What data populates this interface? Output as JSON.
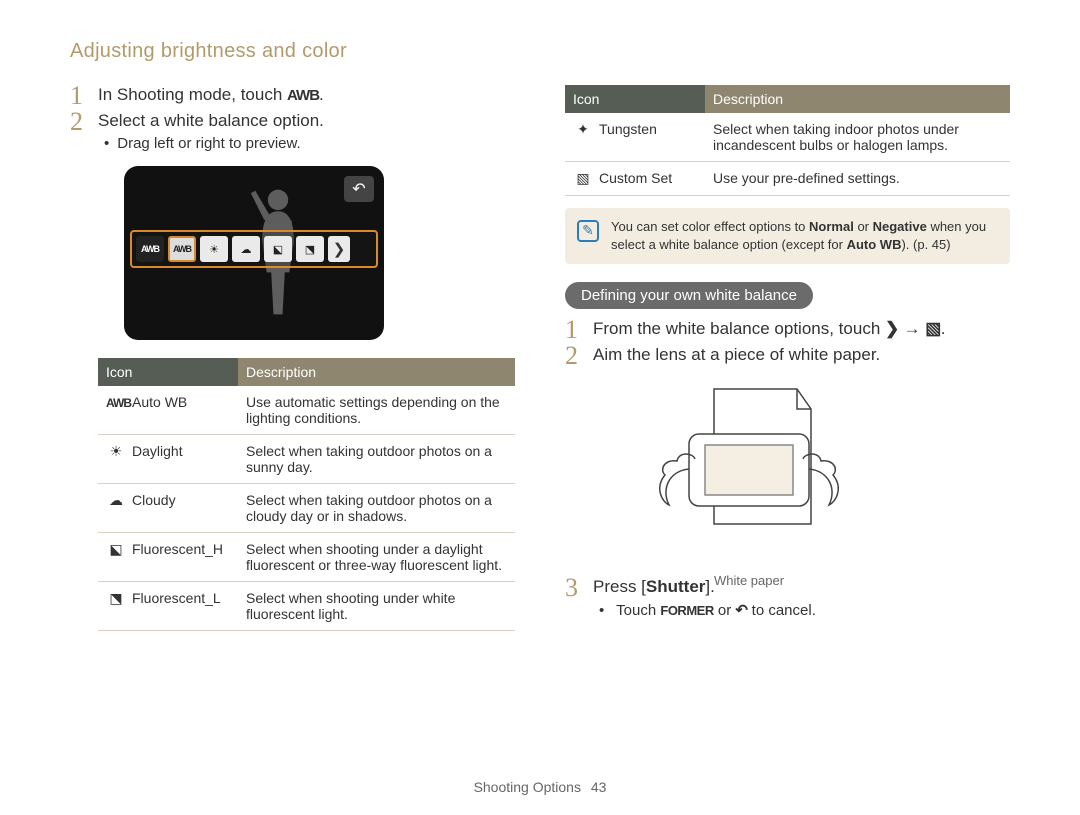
{
  "page_title": "Adjusting brightness and color",
  "left": {
    "step1_prefix": "In Shooting mode, touch ",
    "step1_icon": "AWB",
    "step1_suffix": ".",
    "step2": "Select a white balance option.",
    "step2_sub1": "Drag left or right to preview.",
    "table": {
      "headers": [
        "Icon",
        "Description"
      ],
      "rows": [
        {
          "icon_glyph": "AWB",
          "label": "Auto WB",
          "desc": "Use automatic settings depending on the lighting conditions."
        },
        {
          "icon_glyph": "☀",
          "label": "Daylight",
          "desc": "Select when taking outdoor photos on a sunny day."
        },
        {
          "icon_glyph": "☁",
          "label": "Cloudy",
          "desc": "Select when taking outdoor photos on a cloudy day or in shadows."
        },
        {
          "icon_glyph": "⬕",
          "label": "Fluorescent_H",
          "desc": "Select when shooting under a daylight fluorescent or three-way fluorescent light."
        },
        {
          "icon_glyph": "⬔",
          "label": "Fluorescent_L",
          "desc": "Select when shooting under white fluorescent light."
        }
      ]
    }
  },
  "right": {
    "table": {
      "headers": [
        "Icon",
        "Description"
      ],
      "rows": [
        {
          "icon_glyph": "✦",
          "label": "Tungsten",
          "desc": "Select when taking indoor photos under incandescent bulbs or halogen lamps."
        },
        {
          "icon_glyph": "▧",
          "label": "Custom Set",
          "desc": "Use your pre-defined settings."
        }
      ]
    },
    "note_prefix": "You can set color effect options to ",
    "note_bold1": "Normal",
    "note_mid": " or ",
    "note_bold2": "Negative",
    "note_after": " when you select a white balance option (except for ",
    "note_bold3": "Auto WB",
    "note_end": "). (p. 45)",
    "subheading": "Defining your own white balance",
    "step1_prefix": "From the white balance options, touch ",
    "step1_glyph1": "❯",
    "step1_arrow": " → ",
    "step1_glyph2": "▧",
    "step1_suffix": ".",
    "step2": "Aim the lens at a piece of white paper.",
    "illus_label": "White paper",
    "step3_prefix": "Press [",
    "step3_bold": "Shutter",
    "step3_suffix": "].",
    "step3_sub_prefix": "Touch ",
    "step3_sub_glyph1": "FORMER",
    "step3_sub_mid": " or ",
    "step3_sub_glyph2": "↶",
    "step3_sub_end": " to cancel."
  },
  "footer": {
    "section": "Shooting Options",
    "page": "43"
  }
}
